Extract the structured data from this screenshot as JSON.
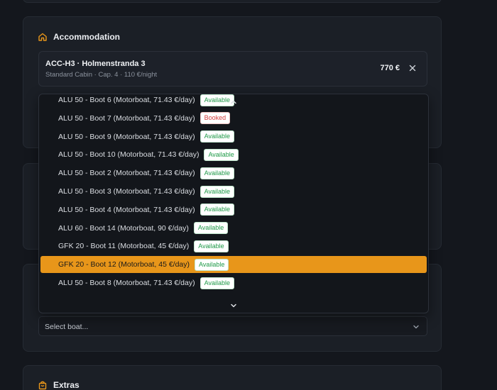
{
  "accommodation": {
    "heading": "Accommodation",
    "item": {
      "title": "ACC-H3 · Holmenstranda 3",
      "subtitle": "Standard Cabin · Cap. 4 · 110 €/night",
      "price": "770 €"
    }
  },
  "boat_select": {
    "placeholder": "Select boat...",
    "options": [
      {
        "label": "ALU 50 - Boot 6 (Motorboat, 71.43 €/day)",
        "status": "Available",
        "status_type": "available"
      },
      {
        "label": "ALU 50 - Boot 7 (Motorboat, 71.43 €/day)",
        "status": "Booked",
        "status_type": "booked"
      },
      {
        "label": "ALU 50 - Boot 9 (Motorboat, 71.43 €/day)",
        "status": "Available",
        "status_type": "available"
      },
      {
        "label": "ALU 50 - Boot 10 (Motorboat, 71.43 €/day)",
        "status": "Available",
        "status_type": "available"
      },
      {
        "label": "ALU 50 - Boot 2 (Motorboat, 71.43 €/day)",
        "status": "Available",
        "status_type": "available"
      },
      {
        "label": "ALU 50 - Boot 3 (Motorboat, 71.43 €/day)",
        "status": "Available",
        "status_type": "available"
      },
      {
        "label": "ALU 50 - Boot 4 (Motorboat, 71.43 €/day)",
        "status": "Available",
        "status_type": "available"
      },
      {
        "label": "ALU 60 - Boot 14 (Motorboat, 90 €/day)",
        "status": "Available",
        "status_type": "available"
      },
      {
        "label": "GFK 20 - Boot 11 (Motorboat, 45 €/day)",
        "status": "Available",
        "status_type": "available"
      },
      {
        "label": "GFK 20 - Boot 12 (Motorboat, 45 €/day)",
        "status": "Available",
        "status_type": "available",
        "highlighted": true
      },
      {
        "label": "ALU 50 - Boot 8 (Motorboat, 71.43 €/day)",
        "status": "Available",
        "status_type": "available"
      }
    ]
  },
  "extras": {
    "heading": "Extras"
  },
  "colors": {
    "accent": "#e8961a",
    "available": "#1f9a48",
    "booked": "#d43b3b",
    "background": "#14171d",
    "card": "#1b1f26"
  },
  "icons": {
    "accommodation": "home-icon",
    "extras": "bag-icon",
    "remove": "close-icon",
    "dropdown": "chevron-down-icon",
    "scroll_up": "chevron-up-icon",
    "scroll_down": "chevron-down-icon"
  }
}
